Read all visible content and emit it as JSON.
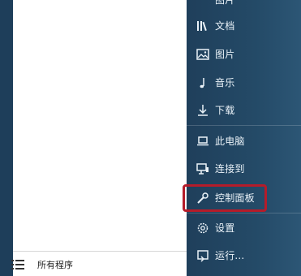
{
  "left": {
    "all_programs": "所有程序"
  },
  "menu": {
    "top_partial": "图片",
    "items": [
      {
        "label": "文档"
      },
      {
        "label": "图片"
      },
      {
        "label": "音乐"
      },
      {
        "label": "下载"
      },
      {
        "label": "此电脑"
      },
      {
        "label": "连接到"
      },
      {
        "label": "控制面板"
      },
      {
        "label": "设置"
      },
      {
        "label": "运行..."
      }
    ]
  },
  "colors": {
    "menu_bg": "#244a67",
    "highlight": "#b51c2a",
    "text": "#eaf2f8"
  }
}
